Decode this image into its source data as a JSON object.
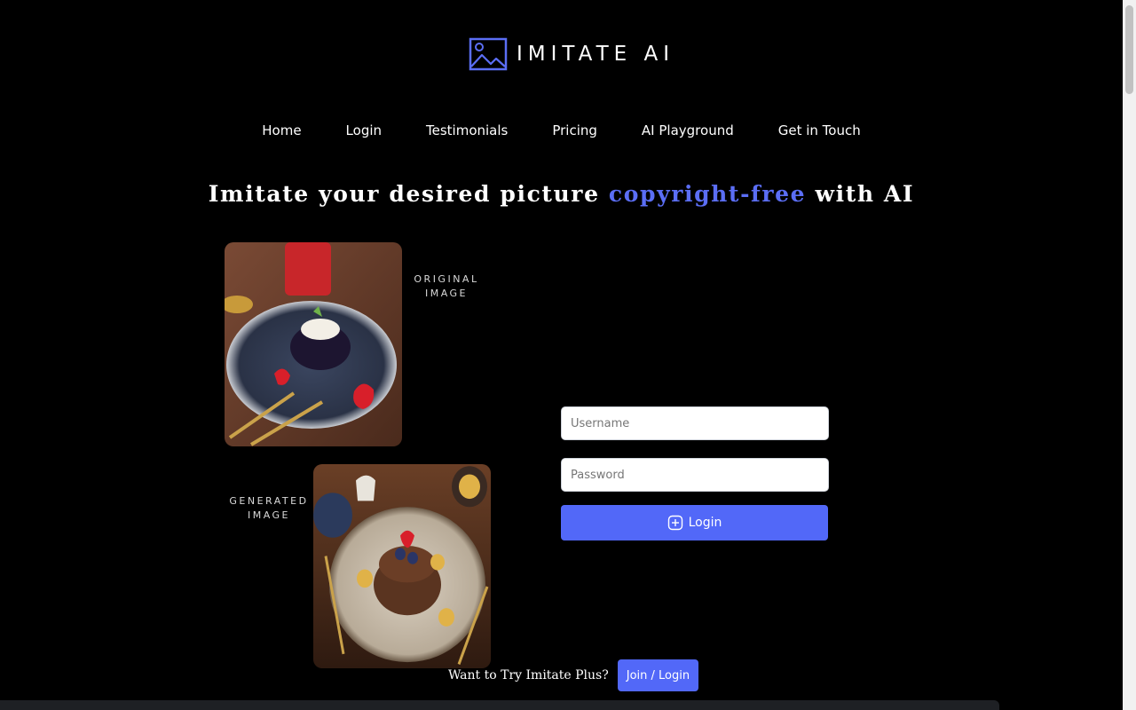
{
  "brand": {
    "name": "IMITATE AI",
    "icon": "image-icon",
    "color": "#5b6ef5"
  },
  "nav": {
    "items": [
      {
        "label": "Home"
      },
      {
        "label": "Login"
      },
      {
        "label": "Testimonials"
      },
      {
        "label": "Pricing"
      },
      {
        "label": "AI Playground"
      },
      {
        "label": "Get in Touch"
      }
    ]
  },
  "headline": {
    "before": "Imitate your desired picture ",
    "accent": "copyright-free",
    "after": " with AI",
    "accent_color": "#5b6ef5"
  },
  "gallery": {
    "original_caption_line1": "ORIGINAL",
    "original_caption_line2": "IMAGE",
    "generated_caption_line1": "GENERATED",
    "generated_caption_line2": "IMAGE"
  },
  "login_form": {
    "username_placeholder": "Username",
    "password_placeholder": "Password",
    "submit_label": "Login",
    "submit_icon": "plus-square-icon",
    "button_color": "#5268f8"
  },
  "cta": {
    "text": "Want to Try Imitate Plus?",
    "button_label": "Join / Login"
  }
}
